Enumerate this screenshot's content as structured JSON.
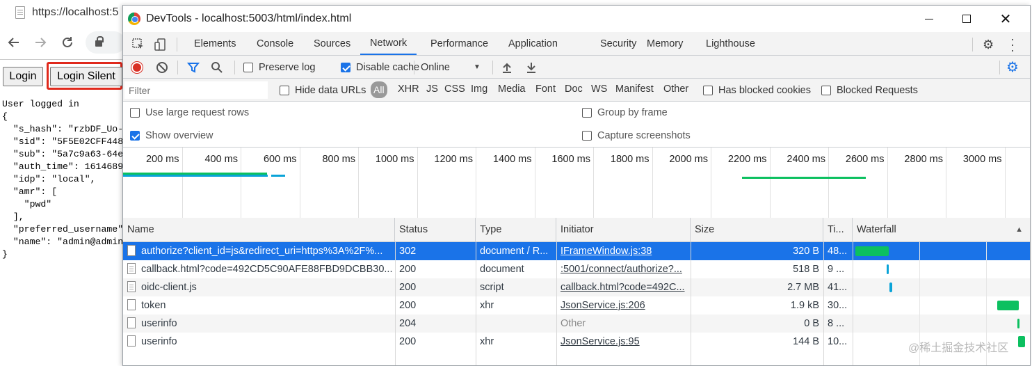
{
  "browser": {
    "tab_title": "https://localhost:5",
    "buttons": {
      "login": "Login",
      "login_silent": "Login Silent"
    },
    "output_lines": [
      "User logged in",
      "{",
      "  \"s_hash\": \"rzbDF_Uo-",
      "  \"sid\": \"5F5E02CFF448",
      "  \"sub\": \"5a7c9a63-64e",
      "  \"auth_time\": 1614689",
      "  \"idp\": \"local\",",
      "  \"amr\": [",
      "    \"pwd\"",
      "  ],",
      "  \"preferred_username\"",
      "  \"name\": \"admin@admin",
      "}"
    ]
  },
  "devtools": {
    "title": "DevTools - localhost:5003/html/index.html",
    "tabs": [
      "Elements",
      "Console",
      "Sources",
      "Network",
      "Performance",
      "Application",
      "Security",
      "Memory",
      "Lighthouse"
    ],
    "active_tab": "Network",
    "toolbar": {
      "preserve_log": "Preserve log",
      "preserve_log_checked": false,
      "disable_cache": "Disable cache",
      "disable_cache_checked": true,
      "throttle": "Online"
    },
    "filter": {
      "placeholder": "Filter",
      "hide_data_urls": "Hide data URLs",
      "types": [
        "All",
        "XHR",
        "JS",
        "CSS",
        "Img",
        "Media",
        "Font",
        "Doc",
        "WS",
        "Manifest",
        "Other"
      ],
      "active_type": "All",
      "has_blocked_cookies": "Has blocked cookies",
      "blocked_requests": "Blocked Requests"
    },
    "options": {
      "large_rows": "Use large request rows",
      "large_rows_checked": false,
      "show_overview": "Show overview",
      "show_overview_checked": true,
      "group_by_frame": "Group by frame",
      "group_by_frame_checked": false,
      "capture_screenshots": "Capture screenshots",
      "capture_screenshots_checked": false
    },
    "overview_ticks": [
      "200 ms",
      "400 ms",
      "600 ms",
      "800 ms",
      "1000 ms",
      "1200 ms",
      "1400 ms",
      "1600 ms",
      "1800 ms",
      "2000 ms",
      "2200 ms",
      "2400 ms",
      "2600 ms",
      "2800 ms",
      "3000 ms",
      "3"
    ],
    "columns": {
      "name": "Name",
      "status": "Status",
      "type": "Type",
      "initiator": "Initiator",
      "size": "Size",
      "time": "Ti...",
      "waterfall": "Waterfall"
    },
    "requests": [
      {
        "name": "authorize?client_id=js&redirect_uri=https%3A%2F%...",
        "status": "302",
        "type": "document / R...",
        "initiator": "IFrameWindow.js:38",
        "size": "320 B",
        "time": "48..."
      },
      {
        "name": "callback.html?code=492CD5C90AFE88FBD9DCBB30...",
        "status": "200",
        "type": "document",
        "initiator": ":5001/connect/authorize?...",
        "size": "518 B",
        "time": "9 ..."
      },
      {
        "name": "oidc-client.js",
        "status": "200",
        "type": "script",
        "initiator": "callback.html?code=492C...",
        "size": "2.7 MB",
        "time": "41..."
      },
      {
        "name": "token",
        "status": "200",
        "type": "xhr",
        "initiator": "JsonService.js:206",
        "size": "1.9 kB",
        "time": "30..."
      },
      {
        "name": "userinfo",
        "status": "204",
        "type": "",
        "initiator": "Other",
        "size": "0 B",
        "time": "8 ..."
      },
      {
        "name": "userinfo",
        "status": "200",
        "type": "xhr",
        "initiator": "JsonService.js:95",
        "size": "144 B",
        "time": "10..."
      }
    ],
    "colors": {
      "accent": "#1a73e8",
      "record": "#d93025",
      "bar_green": "#0cc060",
      "bar_blue": "#0aa3d8"
    }
  },
  "watermark": "@稀土掘金技术社区"
}
